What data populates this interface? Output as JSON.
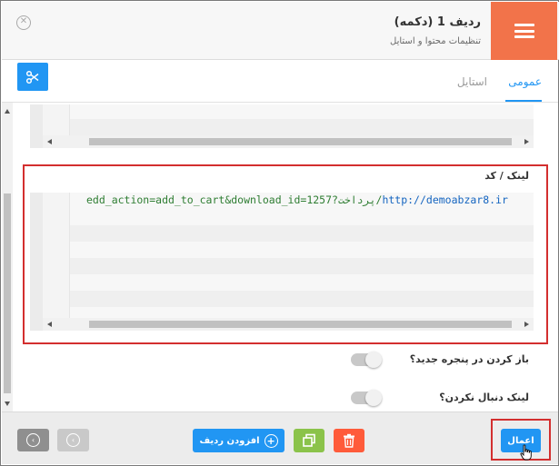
{
  "header": {
    "title": "ردیف 1 (دکمه)",
    "subtitle": "تنظیمات محتوا و استایل",
    "close_icon": "close-circle-icon",
    "menu_icon": "hamburger-icon",
    "accent_color": "#f2734a"
  },
  "tabs": {
    "general": "عمومی",
    "style": "استایل",
    "active": "general",
    "active_color": "#2196f3"
  },
  "link_field": {
    "label": "لینک / کد",
    "code_before": "edd_action=add_to_cart&download_id=1257?",
    "code_middle": "پرداخت/",
    "code_after": "http://demoabzar8.ir"
  },
  "options": {
    "open_new_window": {
      "label": "باز کردن در پنجره جدید؟",
      "enabled": false
    },
    "nofollow": {
      "label": "لینک دنبال نکردن؟",
      "enabled": false
    }
  },
  "footer": {
    "add_row_label": "افزودن ردیف",
    "apply_label": "اعمال"
  }
}
